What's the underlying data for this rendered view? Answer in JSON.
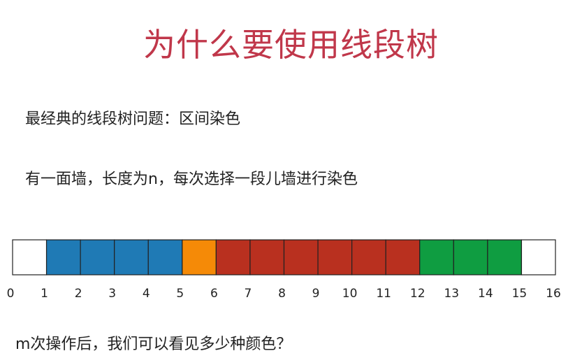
{
  "title": "为什么要使用线段树",
  "lines": [
    "最经典的线段树问题：区间染色",
    "有一面墙，长度为n，每次选择一段儿墙进行染色"
  ],
  "wall": {
    "length": 16,
    "ticks": [
      "0",
      "1",
      "2",
      "3",
      "4",
      "5",
      "6",
      "7",
      "8",
      "9",
      "10",
      "11",
      "12",
      "13",
      "14",
      "15",
      "16"
    ],
    "segments": [
      {
        "start": 0,
        "end": 1,
        "color": "#ffffff"
      },
      {
        "start": 1,
        "end": 5,
        "color": "#1f7ab5"
      },
      {
        "start": 5,
        "end": 6,
        "color": "#f58a07"
      },
      {
        "start": 6,
        "end": 12,
        "color": "#b9301f"
      },
      {
        "start": 12,
        "end": 15,
        "color": "#0f9d41"
      },
      {
        "start": 15,
        "end": 16,
        "color": "#ffffff"
      }
    ]
  },
  "question": "m次操作后，我们可以看见多少种颜色？"
}
